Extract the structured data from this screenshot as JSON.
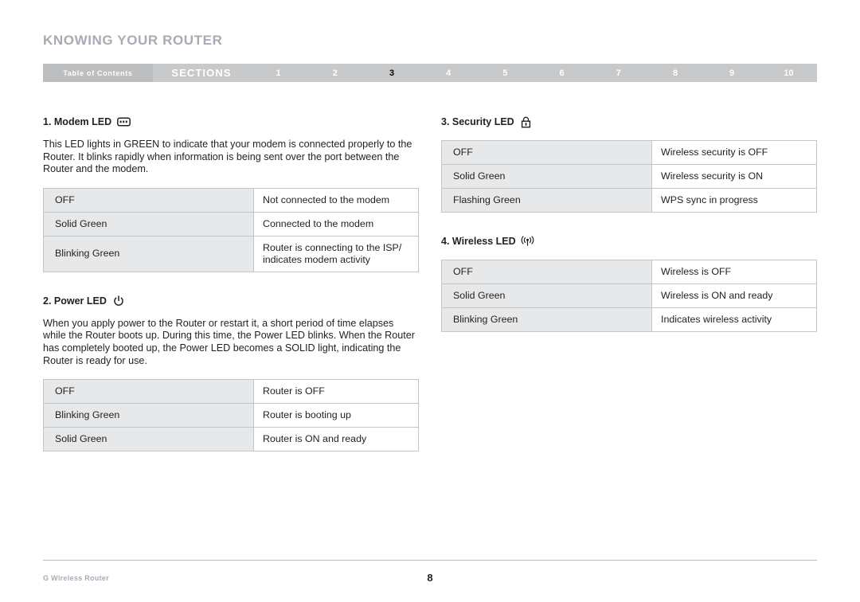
{
  "header": {
    "title": "KNOWING YOUR ROUTER"
  },
  "nav": {
    "toc_label": "Table of Contents",
    "sections_label": "SECTIONS",
    "numbers": [
      "1",
      "2",
      "3",
      "4",
      "5",
      "6",
      "7",
      "8",
      "9",
      "10"
    ],
    "active_number": "3",
    "bar_color": "#c8c9cb",
    "toc_color": "#bcbec0",
    "text_color": "#ffffff",
    "active_text_color": "#000000"
  },
  "sections": [
    {
      "id": "modem-led",
      "heading": "1. Modem LED",
      "icon": "modem-icon",
      "body": "This LED lights in GREEN to indicate that your modem is connected properly to the Router. It blinks rapidly when information is being sent over the port between the Router and the modem.",
      "table": {
        "rows": [
          {
            "state": "OFF",
            "meaning": "Not connected to the modem"
          },
          {
            "state": "Solid Green",
            "meaning": "Connected to the modem"
          },
          {
            "state": "Blinking Green",
            "meaning": "Router is connecting to the ISP/ indicates modem activity"
          }
        ]
      }
    },
    {
      "id": "power-led",
      "heading": "2. Power LED",
      "icon": "power-icon",
      "body": "When you apply power to the Router or restart it, a short period of time elapses while the Router boots up. During this time, the Power LED blinks. When the Router has completely booted up, the Power LED becomes a SOLID light, indicating the Router is ready for use.",
      "table": {
        "rows": [
          {
            "state": "OFF",
            "meaning": "Router is OFF"
          },
          {
            "state": "Blinking Green",
            "meaning": "Router is booting up"
          },
          {
            "state": "Solid Green",
            "meaning": "Router is ON and ready"
          }
        ]
      }
    },
    {
      "id": "security-led",
      "heading": "3. Security LED",
      "icon": "lock-icon",
      "body": "",
      "table": {
        "rows": [
          {
            "state": "OFF",
            "meaning": "Wireless security is OFF"
          },
          {
            "state": "Solid Green",
            "meaning": "Wireless security is ON"
          },
          {
            "state": "Flashing Green",
            "meaning": "WPS sync in progress"
          }
        ]
      }
    },
    {
      "id": "wireless-led",
      "heading": "4. Wireless LED",
      "icon": "wireless-icon",
      "body": "",
      "table": {
        "rows": [
          {
            "state": "OFF",
            "meaning": "Wireless is OFF"
          },
          {
            "state": "Solid Green",
            "meaning": "Wireless is ON and ready"
          },
          {
            "state": "Blinking Green",
            "meaning": "Indicates wireless activity"
          }
        ]
      }
    }
  ],
  "footer": {
    "label": "G Wireless Router",
    "page_number": "8"
  }
}
